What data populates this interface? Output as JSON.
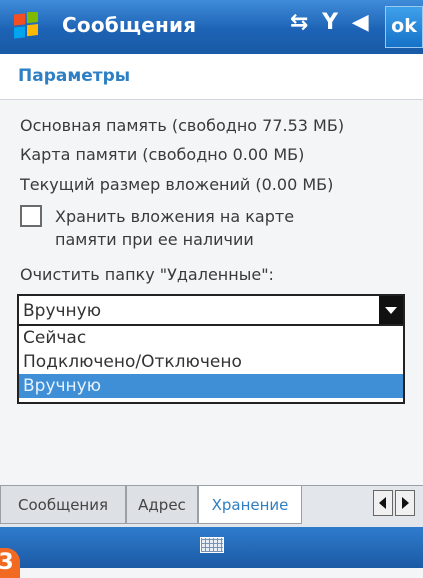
{
  "titlebar": {
    "app_title": "Сообщения",
    "ok_label": "ok",
    "icons": [
      "start-menu-icon",
      "connectivity-icon",
      "signal-off-icon",
      "volume-icon"
    ]
  },
  "header": {
    "title": "Параметры"
  },
  "storage": {
    "main_memory": "Основная память (свободно 77.53 МБ)",
    "memory_card": "Карта памяти (свободно 0.00 МБ)",
    "attachments_size": "Текущий размер вложений (0.00 МБ)",
    "store_on_card_label": "Хранить вложения на карте памяти при ее наличии",
    "store_on_card_checked": false,
    "clear_deleted_label": "Очистить папку \"Удаленные\":"
  },
  "dropdown": {
    "selected_value": "Вручную",
    "options": [
      "Сейчас",
      "Подключено/Отключено",
      "Вручную"
    ],
    "highlighted_index": 2
  },
  "tabs": [
    {
      "label": "Сообщения",
      "active": false
    },
    {
      "label": "Адрес",
      "active": false
    },
    {
      "label": "Хранение",
      "active": true
    }
  ],
  "badge": "3",
  "colors": {
    "accent": "#2e7fc4",
    "titlebar": "#1d63b5",
    "selection": "#3e8fd6"
  }
}
